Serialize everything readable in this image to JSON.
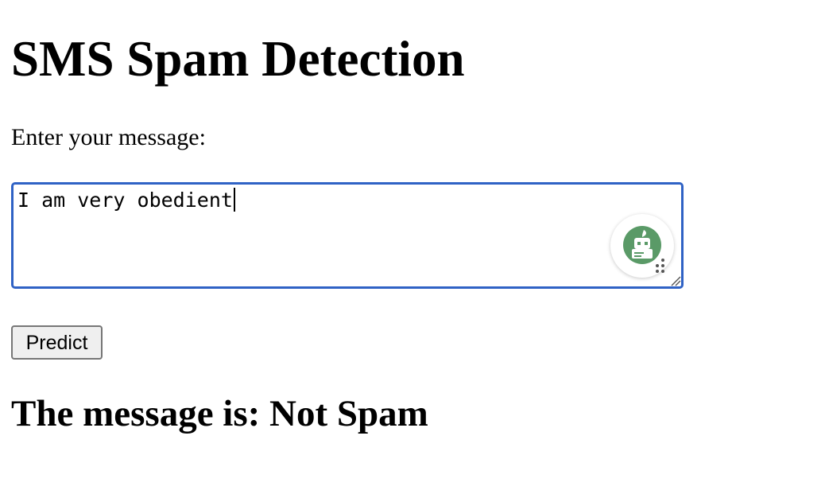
{
  "page": {
    "title": "SMS Spam Detection",
    "prompt_label": "Enter your message:"
  },
  "form": {
    "message_value": "I am very obedient",
    "predict_label": "Predict"
  },
  "result": {
    "text": "The message is: Not Spam"
  },
  "assistant_widget": {
    "icon": "robot-quill-icon",
    "accent_color": "#5a9a67"
  },
  "colors": {
    "focus_border": "#2f62c5",
    "button_bg": "#efefef"
  }
}
